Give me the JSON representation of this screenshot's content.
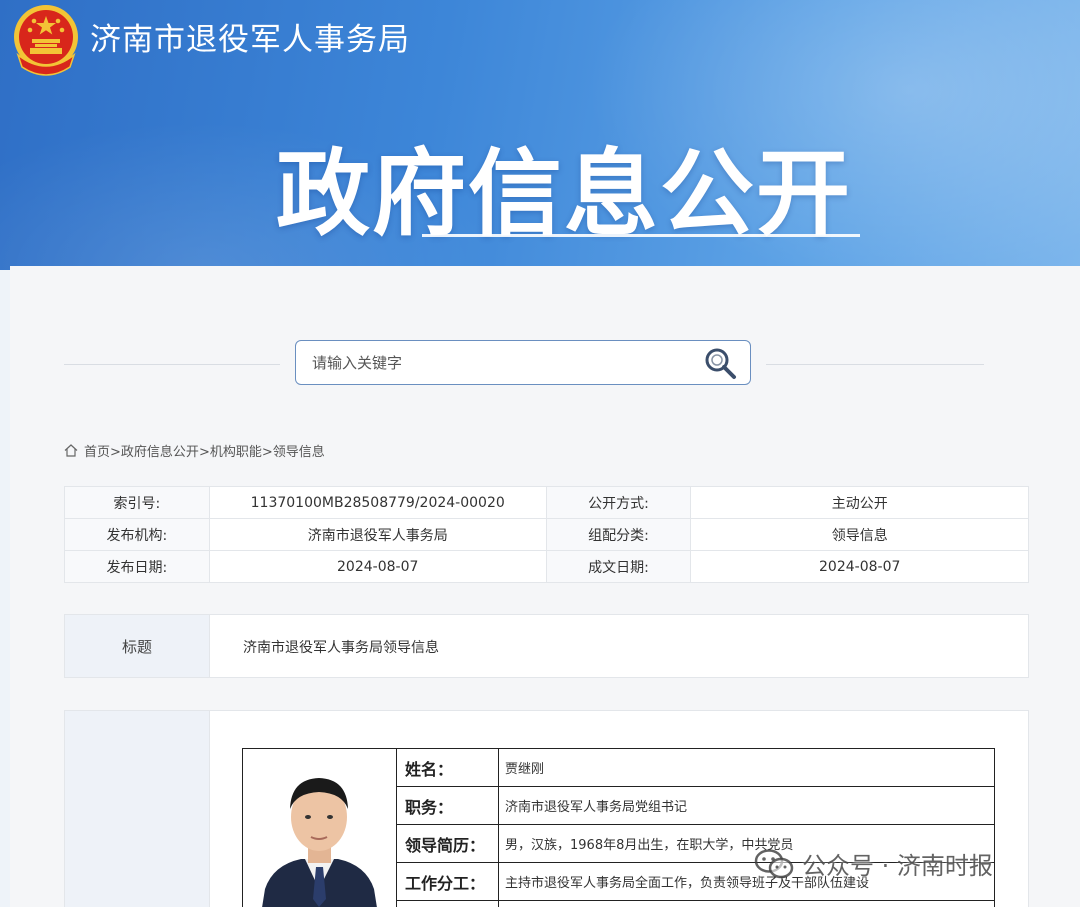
{
  "header": {
    "site_name": "济南市退役军人事务局",
    "hero_title": "政府信息公开",
    "emblem_icon": "national-emblem-icon"
  },
  "search": {
    "placeholder": "请输入关键字",
    "button_icon": "search-icon"
  },
  "breadcrumb": {
    "home_icon": "home-icon",
    "items": [
      "首页",
      "政府信息公开",
      "机构职能",
      "领导信息"
    ],
    "separator": ">"
  },
  "meta": {
    "rows": [
      {
        "k1": "索引号:",
        "v1": "11370100MB28508779/2024-00020",
        "k2": "公开方式:",
        "v2": "主动公开"
      },
      {
        "k1": "发布机构:",
        "v1": "济南市退役军人事务局",
        "k2": "组配分类:",
        "v2": "领导信息"
      },
      {
        "k1": "发布日期:",
        "v1": "2024-08-07",
        "k2": "成文日期:",
        "v2": "2024-08-07"
      }
    ]
  },
  "doc_title": {
    "label": "标题",
    "value": "济南市退役军人事务局领导信息"
  },
  "profile": {
    "rows": [
      {
        "label": "姓名：",
        "value": "贾继刚"
      },
      {
        "label": "职务：",
        "value": "济南市退役军人事务局党组书记"
      },
      {
        "label": "领导简历：",
        "value": "男，汉族，1968年8月出生，在职大学，中共党员"
      },
      {
        "label": "工作分工：",
        "value": "主持市退役军人事务局全面工作，负责领导班子及干部队伍建设"
      }
    ]
  },
  "watermark": {
    "text": "公众号 · 济南时报",
    "icon": "wechat-icon"
  },
  "colors": {
    "banner_blue": "#3d86d8",
    "panel_bg": "#f5f6f8",
    "label_cell_bg": "#eef2f8",
    "emblem_red": "#d8261b",
    "emblem_gold": "#f3c436"
  }
}
